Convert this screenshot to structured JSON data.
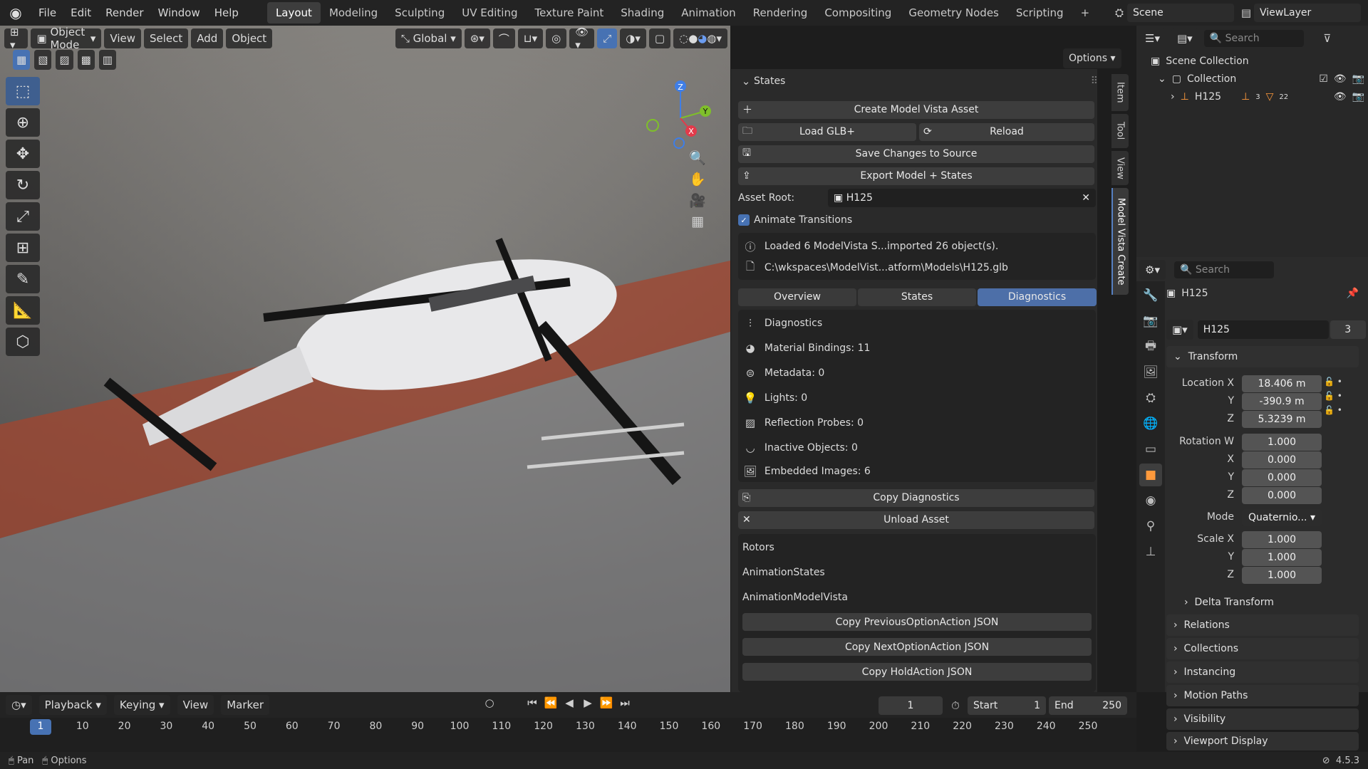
{
  "topbar": {
    "menus": [
      "File",
      "Edit",
      "Render",
      "Window",
      "Help"
    ],
    "workspaces": [
      "Layout",
      "Modeling",
      "Sculpting",
      "UV Editing",
      "Texture Paint",
      "Shading",
      "Animation",
      "Rendering",
      "Compositing",
      "Geometry Nodes",
      "Scripting"
    ],
    "active_workspace": "Layout",
    "add": "+",
    "scene": "Scene",
    "view_layer": "ViewLayer"
  },
  "viewport": {
    "mode": "Object Mode",
    "menus": [
      "View",
      "Select",
      "Add",
      "Object"
    ],
    "orientation": "Global",
    "options": "Options",
    "gizmo": {
      "z": "Z",
      "y": "Y",
      "x": "X"
    }
  },
  "npanel": {
    "header": "States",
    "create": "Create Model Vista Asset",
    "load": "Load GLB+",
    "reload": "Reload",
    "save": "Save Changes to Source",
    "export": "Export Model + States",
    "asset_root_label": "Asset Root:",
    "asset_root": "H125",
    "animate": "Animate Transitions",
    "info1": "Loaded 6 ModelVista S...imported 26 object(s).",
    "info2": "C:\\wkspaces\\ModelVist...atform\\Models\\H125.glb",
    "tabs": [
      "Overview",
      "States",
      "Diagnostics"
    ],
    "active_tab": "Diagnostics",
    "diag": [
      "Diagnostics",
      "Material Bindings: 11",
      "Metadata: 0",
      "Lights: 0",
      "Reflection Probes: 0",
      "Inactive Objects: 0",
      "Embedded Images: 6"
    ],
    "copy_diag": "Copy Diagnostics",
    "unload": "Unload Asset",
    "sections": [
      "Rotors",
      "AnimationStates",
      "AnimationModelVista"
    ],
    "json_buttons": [
      "Copy PreviousOptionAction JSON",
      "Copy NextOptionAction JSON",
      "Copy HoldAction JSON"
    ]
  },
  "sidetabs": [
    "Item",
    "Tool",
    "View",
    "Model Vista Create"
  ],
  "outliner": {
    "search": "Search",
    "scene_collection": "Scene Collection",
    "collection": "Collection",
    "object": "H125",
    "badge1": "3",
    "badge2": "22"
  },
  "props": {
    "search": "Search",
    "object_name": "H125",
    "data_name": "H125",
    "users": "3",
    "transform": "Transform",
    "location_label": "Location X",
    "loc": [
      "18.406 m",
      "-390.9 m",
      "5.3239 m"
    ],
    "rotation_label": "Rotation W",
    "rot": [
      "1.000",
      "0.000",
      "0.000",
      "0.000"
    ],
    "mode_label": "Mode",
    "mode": "Quaternio...",
    "scale_label": "Scale X",
    "scale": [
      "1.000",
      "1.000",
      "1.000"
    ],
    "axis": [
      "Y",
      "Z",
      "X"
    ],
    "sections": [
      "Delta Transform",
      "Relations",
      "Collections",
      "Instancing",
      "Motion Paths",
      "Visibility",
      "Viewport Display"
    ]
  },
  "timeline": {
    "menus": [
      "Playback",
      "Keying",
      "View",
      "Marker"
    ],
    "frame": "1",
    "start_label": "Start",
    "start": "1",
    "end_label": "End",
    "end": "250",
    "ticks": [
      "1",
      "10",
      "20",
      "30",
      "40",
      "50",
      "60",
      "70",
      "80",
      "90",
      "100",
      "110",
      "120",
      "130",
      "140",
      "150",
      "160",
      "170",
      "180",
      "190",
      "200",
      "210",
      "220",
      "230",
      "240",
      "250"
    ]
  },
  "status": {
    "pan": "Pan",
    "options": "Options",
    "version": "4.5.3"
  },
  "colors": {
    "accent": "#4772b3",
    "active_tab": "#4d6fa8",
    "x_axis": "#e23a4a",
    "y_axis": "#7fbf2a",
    "z_axis": "#3f7ee6"
  }
}
